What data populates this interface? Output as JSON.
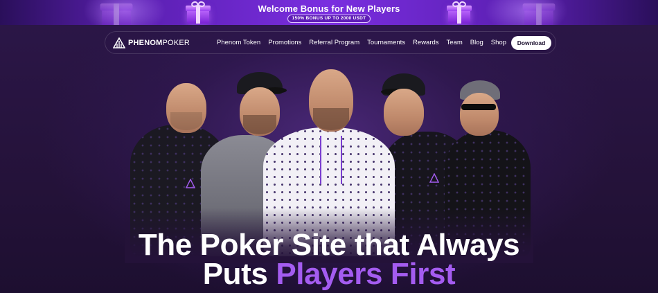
{
  "promo": {
    "title": "Welcome Bonus for New Players",
    "pill": "150% BONUS UP TO 2000 USDT"
  },
  "nav": {
    "logo_bold": "PHENOM",
    "logo_light": "POKER",
    "links": [
      "Phenom Token",
      "Promotions",
      "Referral Program",
      "Tournaments",
      "Rewards",
      "Team",
      "Blog",
      "Shop"
    ],
    "download": "Download"
  },
  "hero": {
    "headline_line1": "The Poker Site that Always",
    "headline_line2_plain": "Puts ",
    "headline_line2_accent": "Players First"
  },
  "colors": {
    "accent": "#a45cf0",
    "banner": "#7a2ee0",
    "background": "#241239"
  }
}
